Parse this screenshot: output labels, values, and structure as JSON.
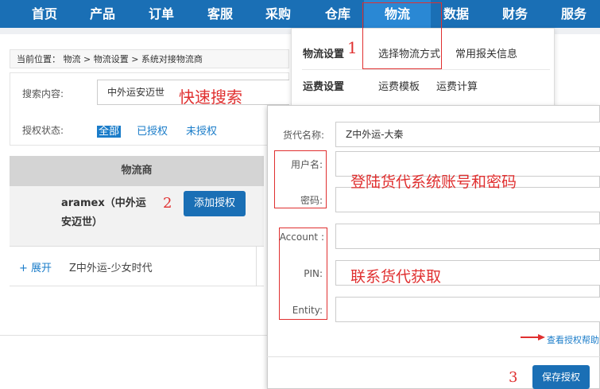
{
  "nav": {
    "items": [
      "首页",
      "产品",
      "订单",
      "客服",
      "采购",
      "仓库",
      "物流",
      "数据",
      "财务",
      "服务"
    ],
    "active": "物流"
  },
  "breadcrumb": "当前位置： 物流 > 物流设置 > 系统对接物流商",
  "search": {
    "label": "搜索内容:",
    "value": "中外运安迈世",
    "annotation": "快速搜索"
  },
  "auth": {
    "label": "授权状态:",
    "options": [
      "全部",
      "已授权",
      "未授权"
    ],
    "selected": "全部"
  },
  "table": {
    "header": "物流商",
    "carrier": "aramex（中外运安迈世）",
    "authorize_button": "添加授权",
    "expand": "+ 展开",
    "sub_name": "Z中外运-少女时代"
  },
  "dropdown": {
    "logistics_settings": "物流设置",
    "choose_method": "选择物流方式",
    "customs_info": "常用报关信息",
    "freight_settings": "运费设置",
    "freight_template": "运费模板",
    "freight_calc": "运费计算"
  },
  "panel": {
    "forwarder_label": "货代名称:",
    "forwarder_value": "Z中外运-大秦",
    "username_label": "用户名:",
    "password_label": "密码:",
    "account_label": "Account :",
    "pin_label": "PIN:",
    "entity_label": "Entity:",
    "help_link": "查看授权帮助",
    "save_button": "保存授权"
  },
  "annotations": {
    "n1": "1",
    "n2": "2",
    "n3": "3",
    "credentials": "登陆货代系统账号和密码",
    "contact": "联系货代获取"
  },
  "colors": {
    "nav_bg": "#1a6fb5",
    "annotation": "#e03030",
    "link": "#1a7cc9"
  }
}
